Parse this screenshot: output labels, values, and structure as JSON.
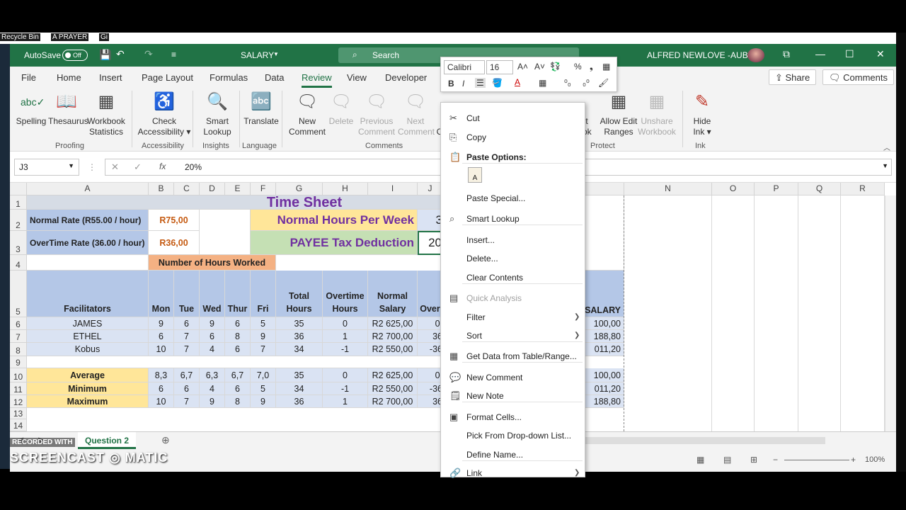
{
  "desktop": {
    "labels": [
      "Recycle Bin",
      "A PRAYER",
      "Gi"
    ]
  },
  "titlebar": {
    "autosave": "AutoSave",
    "autosave_state": "Off",
    "doc_title": "SALARY",
    "search_placeholder": "Search",
    "user": "ALFRED NEWLOVE -AUBIN"
  },
  "tabs": [
    "File",
    "Home",
    "Insert",
    "Page Layout",
    "Formulas",
    "Data",
    "Review",
    "View",
    "Developer"
  ],
  "active_tab": "Review",
  "share": "Share",
  "comments": "Comments",
  "ribbon": {
    "spelling": "Spelling",
    "thesaurus": "Thesaurus",
    "workbook": "Workbook",
    "statistics": "Statistics",
    "check": "Check",
    "accessibility": "Accessibility",
    "smart": "Smart",
    "lookup": "Lookup",
    "translate": "Translate",
    "new": "New",
    "comment": "Comment",
    "delete": "Delete",
    "previous": "Previous",
    "next": "Next",
    "book_part": "ook",
    "allow_edit": "Allow Edit",
    "ranges": "Ranges",
    "unshare": "Unshare",
    "unshare_wb": "Workbook",
    "hide": "Hide",
    "ink": "Ink",
    "groups": [
      "Proofing",
      "Accessibility",
      "Insights",
      "Language",
      "Comments",
      "Protect",
      "Ink"
    ],
    "ct_part": "ct",
    "c_part": "C"
  },
  "formula": {
    "namebox": "J3",
    "fx": "fx",
    "value": "20%"
  },
  "columns": [
    "A",
    "B",
    "C",
    "D",
    "E",
    "F",
    "G",
    "H",
    "I",
    "J",
    "M",
    "N",
    "O",
    "P",
    "Q",
    "R"
  ],
  "rows": [
    "1",
    "2",
    "3",
    "4",
    "5",
    "6",
    "7",
    "8",
    "9",
    "10",
    "11",
    "12",
    "13",
    "14"
  ],
  "sheet": {
    "title": "Time Sheet",
    "normal_rate_label": "Normal Rate (R55.00 / hour)",
    "normal_rate": "R75,00",
    "ot_rate_label": "OverTime Rate (36.00 / hour)",
    "ot_rate": "R36,00",
    "nhpw_label": "Normal Hours Per Week",
    "nhpw_value": "3",
    "payee_label": "PAYEE Tax Deduction",
    "payee_value": "20",
    "hours_worked": "Number of Hours Worked",
    "headers": [
      "Facilitators",
      "Mon",
      "Tue",
      "Wed",
      "Thur",
      "Fri",
      "Total Hours",
      "Overtime Hours",
      "Normal Salary",
      "Over"
    ],
    "salary_header": "SALARY",
    "data_rows": [
      {
        "name": "JAMES",
        "vals": [
          "9",
          "6",
          "9",
          "6",
          "5",
          "35",
          "0",
          "R2 625,00",
          "0,"
        ],
        "salary": "100,00"
      },
      {
        "name": "ETHEL",
        "vals": [
          "6",
          "7",
          "6",
          "8",
          "9",
          "36",
          "1",
          "R2 700,00",
          "36"
        ],
        "salary": "188,80"
      },
      {
        "name": "Kobus",
        "vals": [
          "10",
          "7",
          "4",
          "6",
          "7",
          "34",
          "-1",
          "R2 550,00",
          "-36"
        ],
        "salary": "011,20"
      }
    ],
    "stat_rows": [
      {
        "name": "Average",
        "vals": [
          "8,3",
          "6,7",
          "6,3",
          "6,7",
          "7,0",
          "35",
          "0",
          "R2 625,00",
          "0,"
        ],
        "salary": "100,00"
      },
      {
        "name": "Minimum",
        "vals": [
          "6",
          "6",
          "4",
          "6",
          "5",
          "34",
          "-1",
          "R2 550,00",
          "-36"
        ],
        "salary": "011,20"
      },
      {
        "name": "Maximum",
        "vals": [
          "10",
          "7",
          "9",
          "8",
          "9",
          "36",
          "1",
          "R2 700,00",
          "36"
        ],
        "salary": "188,80"
      }
    ],
    "tab": "Question 2"
  },
  "minitoolbar": {
    "font": "Calibri",
    "size": "16",
    "b": "B",
    "i": "I"
  },
  "context_menu": [
    {
      "label": "Cut",
      "icon": "cut-icon",
      "glyph": "✂"
    },
    {
      "label": "Copy",
      "icon": "copy-icon",
      "glyph": "⎘"
    },
    {
      "label": "Paste Options:",
      "icon": "paste-icon",
      "glyph": "📋",
      "bold": true
    },
    {
      "label": "Paste Special...",
      "icon": "",
      "glyph": ""
    },
    {
      "label": "Smart Lookup",
      "icon": "search-icon",
      "glyph": "⌕"
    },
    {
      "label": "Insert...",
      "icon": "",
      "glyph": ""
    },
    {
      "label": "Delete...",
      "icon": "",
      "glyph": ""
    },
    {
      "label": "Clear Contents",
      "icon": "",
      "glyph": ""
    },
    {
      "label": "Quick Analysis",
      "icon": "quick-analysis-icon",
      "glyph": "▤",
      "disabled": true
    },
    {
      "label": "Filter",
      "icon": "",
      "glyph": "",
      "sub": true
    },
    {
      "label": "Sort",
      "icon": "",
      "glyph": "",
      "sub": true
    },
    {
      "label": "Get Data from Table/Range...",
      "icon": "table-icon",
      "glyph": "▦"
    },
    {
      "label": "New Comment",
      "icon": "new-comment-icon",
      "glyph": "💬"
    },
    {
      "label": "New Note",
      "icon": "new-note-icon",
      "glyph": "🗒"
    },
    {
      "label": "Format Cells...",
      "icon": "format-cells-icon",
      "glyph": "▣"
    },
    {
      "label": "Pick From Drop-down List...",
      "icon": "",
      "glyph": ""
    },
    {
      "label": "Define Name...",
      "icon": "",
      "glyph": ""
    },
    {
      "label": "Link",
      "icon": "link-icon",
      "glyph": "🔗",
      "sub": true
    }
  ],
  "status": {
    "zoom": "100%"
  },
  "watermark": {
    "rec": "RECORDED WITH",
    "brand_a": "SCREENCAST",
    "brand_b": "MATIC"
  }
}
